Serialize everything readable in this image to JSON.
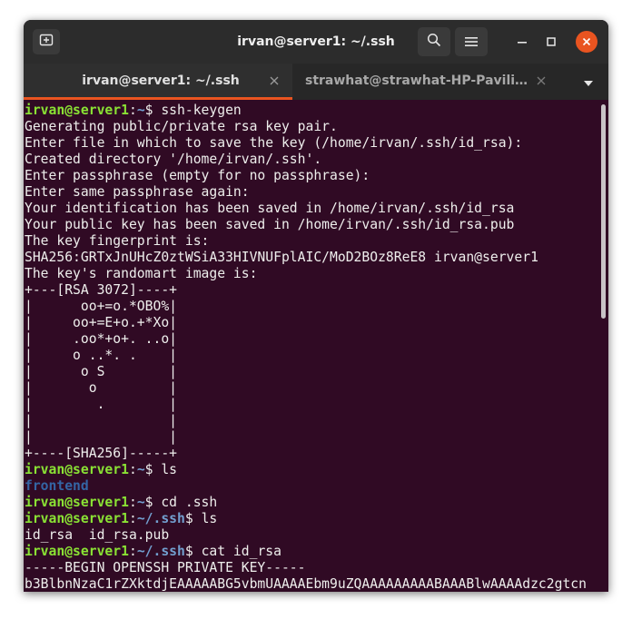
{
  "window": {
    "title": "irvan@server1: ~/.ssh"
  },
  "tabs": [
    {
      "label": "irvan@server1: ~/.ssh",
      "active": true
    },
    {
      "label": "strawhat@strawhat-HP-Pavilion-Notebook: ~",
      "active": false
    }
  ],
  "colors": {
    "terminal_bg": "#300a24",
    "prompt_user": "#8ae234",
    "prompt_path": "#729fcf",
    "directory": "#3465a4",
    "close_button": "#e95420"
  },
  "icons": {
    "new_tab": "new-tab-icon",
    "search": "search-icon",
    "menu": "hamburger-menu-icon",
    "minimize": "minimize-icon",
    "maximize": "maximize-icon",
    "close": "close-icon",
    "tab_close": "close-icon",
    "dropdown": "chevron-down-icon"
  },
  "terminal": {
    "lines": [
      {
        "user": "irvan@server1",
        "sep": ":",
        "path": "~",
        "sym": "$ ",
        "cmd": "ssh-keygen"
      },
      {
        "text": "Generating public/private rsa key pair."
      },
      {
        "text": "Enter file in which to save the key (/home/irvan/.ssh/id_rsa):"
      },
      {
        "text": "Created directory '/home/irvan/.ssh'."
      },
      {
        "text": "Enter passphrase (empty for no passphrase):"
      },
      {
        "text": "Enter same passphrase again:"
      },
      {
        "text": "Your identification has been saved in /home/irvan/.ssh/id_rsa"
      },
      {
        "text": "Your public key has been saved in /home/irvan/.ssh/id_rsa.pub"
      },
      {
        "text": "The key fingerprint is:"
      },
      {
        "text": "SHA256:GRTxJnUHcZ0ztWSiA33HIVNUFplAIC/MoD2BOz8ReE8 irvan@server1"
      },
      {
        "text": "The key's randomart image is:"
      },
      {
        "text": "+---[RSA 3072]----+"
      },
      {
        "text": "|      oo+=o.*OBO%|"
      },
      {
        "text": "|     oo+=E+o.+*Xo|"
      },
      {
        "text": "|     .oo*+o+. ..o|"
      },
      {
        "text": "|     o ..*. .    |"
      },
      {
        "text": "|      o S        |"
      },
      {
        "text": "|       o         |"
      },
      {
        "text": "|        .        |"
      },
      {
        "text": "|                 |"
      },
      {
        "text": "|                 |"
      },
      {
        "text": "+----[SHA256]-----+"
      },
      {
        "user": "irvan@server1",
        "sep": ":",
        "path": "~",
        "sym": "$ ",
        "cmd": "ls"
      },
      {
        "dir": "frontend"
      },
      {
        "user": "irvan@server1",
        "sep": ":",
        "path": "~",
        "sym": "$ ",
        "cmd": "cd .ssh"
      },
      {
        "user": "irvan@server1",
        "sep": ":",
        "path": "~/.ssh",
        "sym": "$ ",
        "cmd": "ls"
      },
      {
        "text": "id_rsa  id_rsa.pub"
      },
      {
        "user": "irvan@server1",
        "sep": ":",
        "path": "~/.ssh",
        "sym": "$ ",
        "cmd": "cat id_rsa"
      },
      {
        "text": "-----BEGIN OPENSSH PRIVATE KEY-----"
      },
      {
        "text": "b3BlbnNzaC1rZXktdjEAAAAABG5vbmUAAAAEbm9uZQAAAAAAAAABAAABlwAAAAdzc2gtcn"
      }
    ]
  }
}
